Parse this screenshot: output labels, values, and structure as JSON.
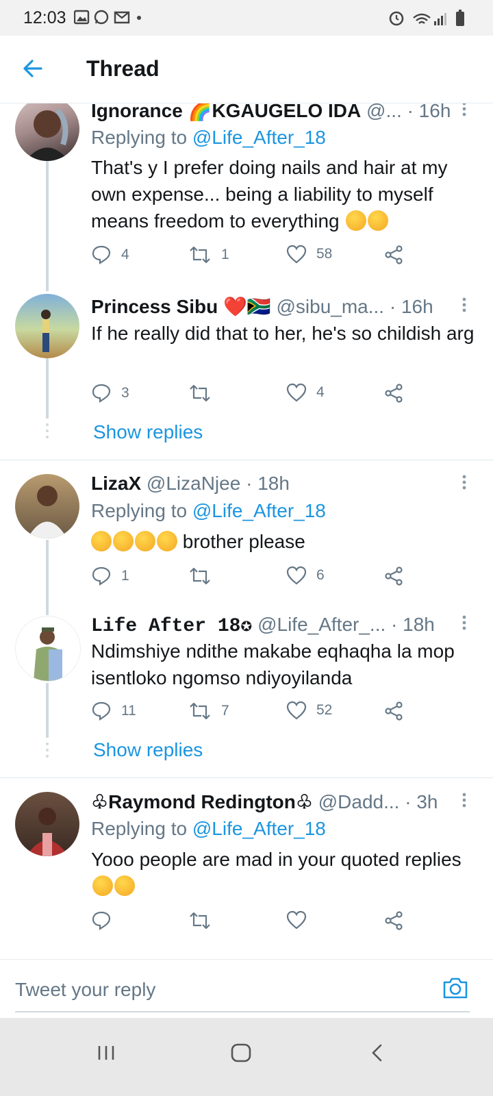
{
  "status_bar": {
    "time": "12:03"
  },
  "header": {
    "title": "Thread"
  },
  "tweets": [
    {
      "name": "Ignorance 🌈KGAUGELO IDA",
      "handle": "@...",
      "separator": "·",
      "time": "16h",
      "replying_prefix": "Replying to",
      "replying_to": "@Life_After_18",
      "text": "That's y I prefer doing nails and hair at my own expense... being a liability to myself means freedom to everything",
      "replies": "4",
      "retweets": "1",
      "likes": "58"
    },
    {
      "name": "Princess Sibu ❤️🇿🇦",
      "handle": "@sibu_ma...",
      "separator": "·",
      "time": "16h",
      "text": "If he really did that to her, he's so childish arg",
      "replies": "3",
      "retweets": "",
      "likes": "4",
      "show_replies": "Show replies"
    },
    {
      "name": "LizaX",
      "handle": "@LizaNjee",
      "separator": "·",
      "time": "18h",
      "replying_prefix": "Replying to",
      "replying_to": "@Life_After_18",
      "text": "brother please",
      "replies": "1",
      "retweets": "",
      "likes": "6"
    },
    {
      "name": "Life After 18✪",
      "handle": "@Life_After_...",
      "separator": "·",
      "time": "18h",
      "text": "Ndimshiye ndithe makabe eqhaqha la mop isentloko ngomso ndiyoyilanda",
      "replies": "11",
      "retweets": "7",
      "likes": "52",
      "show_replies": "Show replies"
    },
    {
      "name": "♧Raymond Redington♧",
      "handle": "@Dadd...",
      "separator": "·",
      "time": "3h",
      "replying_prefix": "Replying to",
      "replying_to": "@Life_After_18",
      "text": "Yooo people are mad in your quoted replies",
      "replies": "",
      "retweets": "",
      "likes": ""
    }
  ],
  "reply_box": {
    "placeholder": "Tweet your reply"
  },
  "colors": {
    "accent": "#1b95e0",
    "secondary_text": "#657786",
    "thread_line": "#cfd9de",
    "like": "#1b95e0"
  }
}
